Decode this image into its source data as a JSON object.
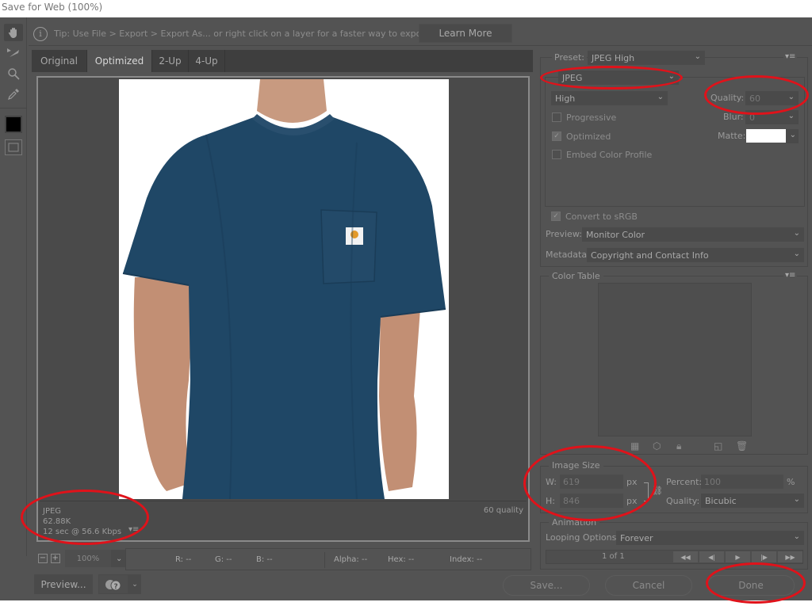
{
  "window": {
    "title": "Save for Web (100%)"
  },
  "tools": [
    {
      "name": "hand-tool",
      "icon": "hand-icon"
    },
    {
      "name": "slice-select-tool",
      "icon": "slice-select-icon"
    },
    {
      "name": "zoom-tool",
      "icon": "magnifier-icon"
    },
    {
      "name": "eyedropper-tool",
      "icon": "eyedropper-icon"
    }
  ],
  "tip": {
    "text": "Tip: Use File > Export > Export As...  or right click on a layer for a faster way to export assets",
    "learn_more": "Learn More"
  },
  "tabs": [
    {
      "label": "Original",
      "active": false
    },
    {
      "label": "Optimized",
      "active": true
    },
    {
      "label": "2-Up",
      "active": false
    },
    {
      "label": "4-Up",
      "active": false
    }
  ],
  "image_info": {
    "format": "JPEG",
    "size": "62.88K",
    "download_time": "12 sec @ 56.6 Kbps",
    "quality": "60 quality",
    "menu_icon": "≡"
  },
  "zoom": {
    "minus": "−",
    "plus": "+",
    "value": "100%"
  },
  "readout": {
    "r": "R: --",
    "g": "G: --",
    "b": "B: --",
    "alpha": "Alpha: --",
    "hex": "Hex: --",
    "index": "Index: --"
  },
  "bottom_buttons": {
    "preview": "Preview...",
    "save": "Save...",
    "cancel": "Cancel",
    "done": "Done"
  },
  "settings": {
    "preset_label": "Preset:",
    "preset_value": "JPEG High",
    "format_value": "JPEG",
    "compression_value": "High",
    "quality_label": "Quality:",
    "quality_value": "60",
    "blur_label": "Blur:",
    "blur_value": "0",
    "matte_label": "Matte:",
    "matte_color": "#ffffff",
    "progressive": {
      "label": "Progressive",
      "checked": false
    },
    "optimized": {
      "label": "Optimized",
      "checked": true
    },
    "embed_color_profile": {
      "label": "Embed Color Profile",
      "checked": false
    },
    "convert_srgb": {
      "label": "Convert to sRGB",
      "checked": true
    },
    "preview_label": "Preview:",
    "preview_value": "Monitor Color",
    "metadata_label": "Metadata:",
    "metadata_value": "Copyright and Contact Info"
  },
  "color_table": {
    "title": "Color Table"
  },
  "image_size": {
    "title": "Image Size",
    "w_label": "W:",
    "w_value": "619",
    "w_unit": "px",
    "h_label": "H:",
    "h_value": "846",
    "h_unit": "px",
    "percent_label": "Percent:",
    "percent_value": "100",
    "percent_unit": "%",
    "quality_label": "Quality:",
    "quality_value": "Bicubic"
  },
  "animation": {
    "title": "Animation",
    "looping_label": "Looping Options:",
    "looping_value": "Forever",
    "frame_counter": "1 of 1"
  },
  "annotation_color": "#e0121a"
}
